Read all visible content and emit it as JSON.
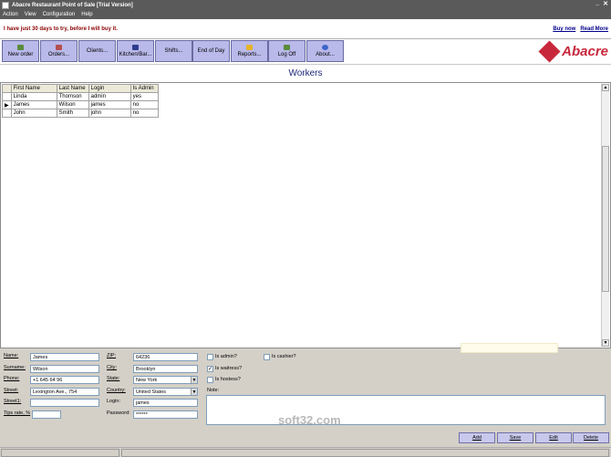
{
  "window": {
    "title": "Abacre Restaurant Point of Sale [Trial Version]",
    "controls": [
      "_",
      "✕"
    ]
  },
  "menu": [
    "Action",
    "View",
    "Configuration",
    "Help"
  ],
  "trial": {
    "message": "I have just 30 days to try, before I will buy it.",
    "buy_now": "Buy now",
    "read_more": "Read More"
  },
  "toolbar": [
    {
      "label": "New order",
      "icon": "new-order-icon",
      "color": "#5a8c3c"
    },
    {
      "label": "Orders...",
      "icon": "orders-icon",
      "color": "#b45050"
    },
    {
      "label": "Clients...",
      "icon": "",
      "color": ""
    },
    {
      "label": "Kitchen/Bar...",
      "icon": "kitchen-icon",
      "color": "#2d3c8c"
    },
    {
      "label": "Shifts...",
      "icon": "",
      "color": ""
    },
    {
      "label": "End of Day",
      "icon": "",
      "color": ""
    },
    {
      "label": "Reports...",
      "icon": "reports-icon",
      "color": "#e6b428"
    },
    {
      "label": "Log Off",
      "icon": "logoff-icon",
      "color": "#5a8c3c"
    },
    {
      "label": "About...",
      "icon": "about-icon",
      "color": "#3c64c8"
    }
  ],
  "logo": {
    "text": "Abacre",
    "color": "#c8283c"
  },
  "page_title": "Workers",
  "grid": {
    "columns": [
      "First Name",
      "Last Name",
      "Login",
      "Is Admin"
    ],
    "rows": [
      [
        "Linda",
        "Thomson",
        "admin",
        "yes"
      ],
      [
        "James",
        "Wilson",
        "james",
        "no"
      ],
      [
        "John",
        "Smith",
        "john",
        "no"
      ]
    ],
    "selected_row": 1
  },
  "form": {
    "name_label": "Name:",
    "name": "James",
    "surname_label": "Surname:",
    "surname": "Wilson",
    "phone_label": "Phone:",
    "phone": "+1 645 64 96",
    "street_label": "Street:",
    "street": "Lexington Ave., 754",
    "street1_label": "Street1:",
    "street1": "",
    "tips_label": "Tips rate, %",
    "tips": "",
    "zip_label": "ZIP:",
    "zip": "64236",
    "city_label": "City:",
    "city": "Brooklyn",
    "state_label": "State:",
    "state": "New York",
    "country_label": "Country:",
    "country": "United States",
    "login_label": "Login:",
    "login": "james",
    "password_label": "Password:",
    "password": "******",
    "is_admin_label": "Is admin?",
    "is_admin": false,
    "is_cashier_label": "Is cashier?",
    "is_cashier": false,
    "is_waitress_label": "Is waitress?",
    "is_waitress": true,
    "is_hostess_label": "Is hostess?",
    "is_hostess": false,
    "note_label": "Note:",
    "note": ""
  },
  "buttons": {
    "add": "Add",
    "save": "Save",
    "edit": "Edit",
    "delete": "Delete"
  },
  "watermark": "soft32.com"
}
